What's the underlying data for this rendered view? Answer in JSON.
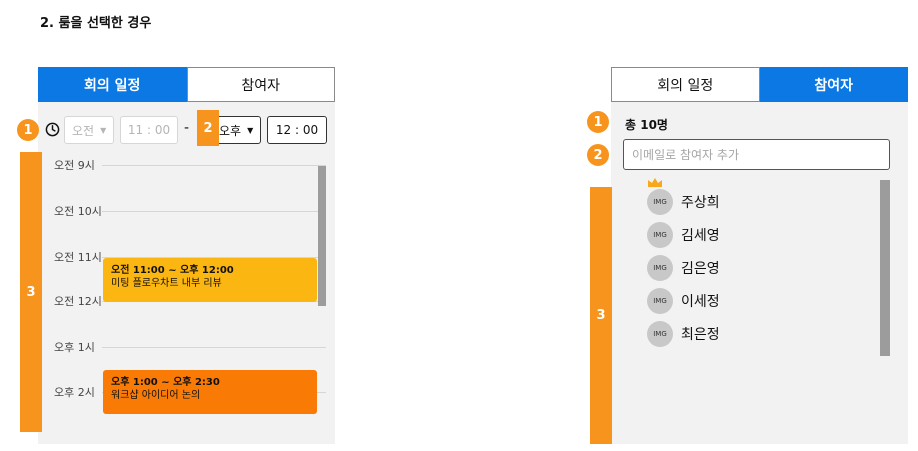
{
  "heading": "2. 룸을 선택한 경우",
  "left": {
    "tabs": [
      "회의 일정",
      "참여자"
    ],
    "active_tab": 0,
    "time": {
      "start_period": "오전",
      "start_time": "11 : 00",
      "separator": "-",
      "end_period": "오후",
      "end_time": "12 : 00"
    },
    "hours": [
      "오전 9시",
      "오전 10시",
      "오전 11시",
      "오전 12시",
      "오후 1시",
      "오후 2시"
    ],
    "events": [
      {
        "time": "오전 11:00 ~ 오후 12:00",
        "title": "미팅 플로우차트 내부 리뷰",
        "color": "#fbb612"
      },
      {
        "time": "오후 1:00 ~ 오후 2:30",
        "title": "워크샵 아이디어 논의",
        "color": "#f97a05"
      }
    ]
  },
  "right": {
    "tabs": [
      "회의 일정",
      "참여자"
    ],
    "active_tab": 1,
    "count": "총 10명",
    "email_placeholder": "이메일로 참여자 추가",
    "avatar_text": "IMG",
    "participants": [
      {
        "name": "주상희",
        "host": true
      },
      {
        "name": "김세영",
        "host": false
      },
      {
        "name": "김은영",
        "host": false
      },
      {
        "name": "이세정",
        "host": false
      },
      {
        "name": "최은정",
        "host": false
      }
    ]
  },
  "annotations": {
    "left": [
      "1",
      "2",
      "3"
    ],
    "right": [
      "1",
      "2",
      "3"
    ]
  },
  "colors": {
    "accent": "#0b78e3",
    "annotation": "#f7941e",
    "event_yellow": "#fbb612",
    "event_orange": "#f97a05"
  },
  "icons": {
    "clock": "clock-icon",
    "caret": "caret-down-icon",
    "crown": "crown-icon"
  }
}
